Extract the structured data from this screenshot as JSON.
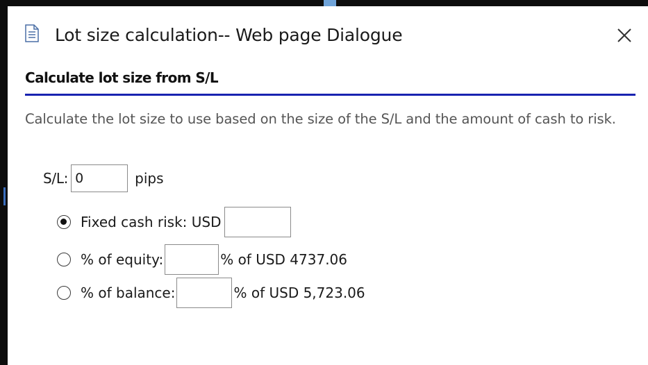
{
  "window": {
    "title": "Lot size calculation-- Web page Dialogue",
    "title_icon": "document-icon",
    "close_icon": "close-icon"
  },
  "section": {
    "heading": "Calculate lot size from S/L",
    "description": "Calculate the lot size to use based on the size of the S/L and the amount of cash to risk.",
    "accent_color": "#1822b0"
  },
  "sl": {
    "label": "S/L:",
    "value": "0",
    "unit": "pips"
  },
  "risk_options": {
    "selected": "fixed",
    "fixed": {
      "label": "Fixed cash risk: USD",
      "value": ""
    },
    "equity": {
      "label": "% of equity:",
      "value": "",
      "suffix": "% of USD 4737.06"
    },
    "balance": {
      "label": "% of balance:",
      "value": "",
      "suffix": "% of USD 5,723.06"
    }
  }
}
